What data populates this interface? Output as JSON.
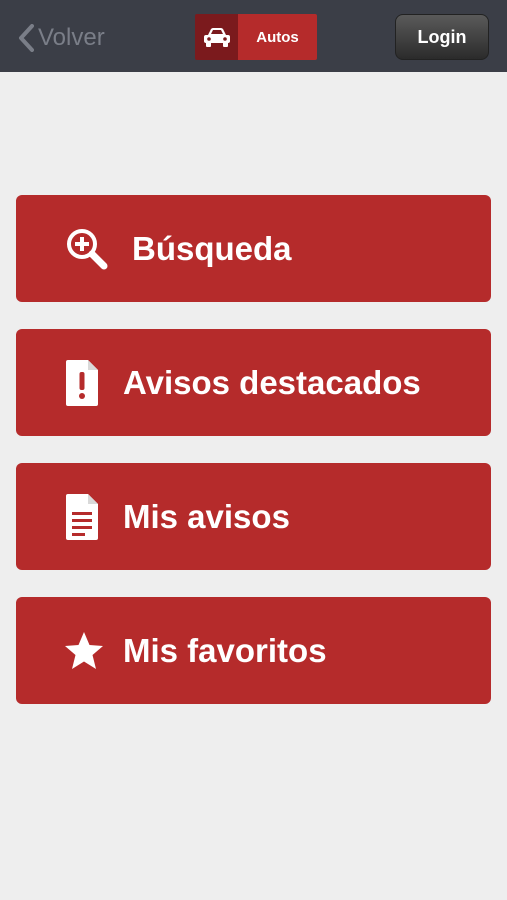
{
  "navbar": {
    "back_label": "Volver",
    "section_label": "Autos",
    "login_label": "Login"
  },
  "menu": [
    {
      "label": "Búsqueda",
      "icon": "search-plus-icon"
    },
    {
      "label": "Avisos destacados",
      "icon": "document-exclamation-icon"
    },
    {
      "label": "Mis avisos",
      "icon": "document-icon"
    },
    {
      "label": "Mis favoritos",
      "icon": "star-icon"
    }
  ],
  "colors": {
    "navbar": "#3b3e47",
    "accent": "#b52b2b",
    "accent_dark": "#7b1a1d",
    "background": "#eeeeee"
  }
}
